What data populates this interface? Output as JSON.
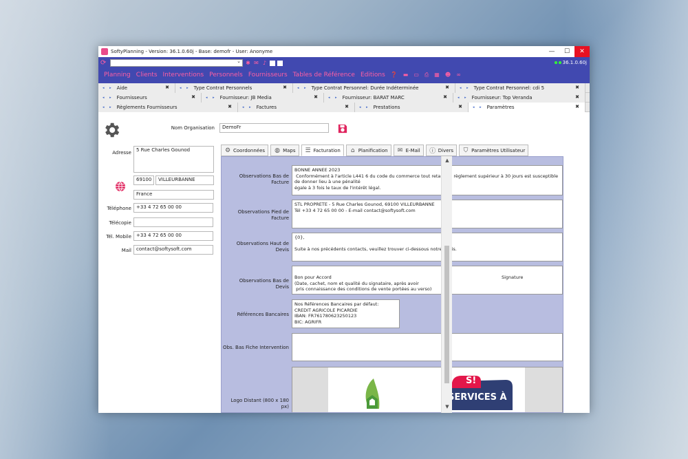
{
  "window": {
    "title": "SoftyPlanning - Version: 36.1.0.60j - Base: demofr - User: Anonyme",
    "controls": {
      "minimize": "—",
      "maximize": "☐",
      "close": "✕"
    }
  },
  "toolbar": {
    "combo_value": "",
    "version": "36.1.0.60j",
    "icons": [
      "refresh-icon",
      "puzzle-icon",
      "mail-icon",
      "microphone-icon"
    ]
  },
  "menu": {
    "items": [
      "Planning",
      "Clients",
      "Interventions",
      "Personnels",
      "Fournisseurs",
      "Tables de Référence",
      "Editions"
    ],
    "icons": [
      "help-icon",
      "folder-icon",
      "folder-open-icon",
      "print-icon",
      "calendar-icon",
      "user-add-icon",
      "link-icon"
    ]
  },
  "doc_tabs": {
    "row1": [
      {
        "label": "Aide",
        "close": "✖"
      },
      {
        "label": "Type Contrat Personnels",
        "close": "✖"
      },
      {
        "label": "Type Contrat Personnel: Durée Indéterminée",
        "close": "✖"
      },
      {
        "label": "Type Contrat Personnel: cdi 5",
        "close": "✖"
      }
    ],
    "row2": [
      {
        "label": "Fournisseurs",
        "close": "✖"
      },
      {
        "label": "Fournisseur: JB Media",
        "close": "✖"
      },
      {
        "label": "Fournisseur: BARAT MARC",
        "close": "✖"
      },
      {
        "label": "Fournisseur: Top Veranda",
        "close": "✖"
      }
    ],
    "row3": [
      {
        "label": "Règlements Fournisseurs",
        "close": "✖"
      },
      {
        "label": "Factures",
        "close": "✖"
      },
      {
        "label": "Prestations",
        "close": "✖"
      },
      {
        "label": "Paramètres",
        "close": "✖"
      }
    ],
    "nav": "◂ ▸"
  },
  "organisation": {
    "name_label": "Nom Organisation",
    "name_value": "DemoFr"
  },
  "address": {
    "label": "Adresse",
    "street": "5 Rue Charles Gounod",
    "postcode": "69100",
    "city": "VILLEURBANNE",
    "country": "France",
    "phone_label": "Téléphone",
    "phone": "+33 4 72 65 00 00",
    "fax_label": "Télécopie",
    "fax": "",
    "mobile_label": "Tél. Mobile",
    "mobile": "+33 4 72 65 00 00",
    "mail_label": "Mail",
    "mail": "contact@softysoft.com"
  },
  "section_tabs": [
    {
      "label": "Coordonnées",
      "icon": "gear-icon"
    },
    {
      "label": "Maps",
      "icon": "globe-icon"
    },
    {
      "label": "Facturation",
      "icon": "list-check-icon"
    },
    {
      "label": "Planification",
      "icon": "bank-icon"
    },
    {
      "label": "E-Mail",
      "icon": "mail-icon"
    },
    {
      "label": "Divers",
      "icon": "info-icon"
    },
    {
      "label": "Paramètres Utilisateur",
      "icon": "shield-icon"
    }
  ],
  "facturation": {
    "obs_bas_facture_label": "Observations Bas de Facture",
    "obs_bas_facture": "BONNE ANNEE 2023\n Conformément à l'article L441 6 du code du commerce tout retard de règlement supérieur à 30 jours est susceptible de donner lieu à une pénalité\négale à 3 fois le taux de l'intérêt légal.",
    "obs_pied_facture_label": "Observations Pied de Facture",
    "obs_pied_facture": "STL PROPRETE - 5 Rue Charles Gounod, 69100 VILLEURBANNE\nTél +33 4 72 65 00 00 - E-mail contact@softysoft.com",
    "obs_haut_devis_label": "Observations Haut de Devis",
    "obs_haut_devis": "{0},\n\nSuite à nos précédents contacts, veuillez trouver ci-dessous notre devis.",
    "obs_bas_devis_label": "Observations Bas de Devis",
    "obs_bas_devis_line1": "Bon pour Accord",
    "obs_bas_devis_signature": "Signature",
    "obs_bas_devis_line2": "(Date, cachet, nom et qualité du signataire, après avoir\n pris connaissance des conditions de vente portées au verso)",
    "ref_bancaires_label": "Références Bancaires",
    "ref_bancaires": "Nos Références Bancaires par défaut:\nCREDIT AGRICOLE PICARDIE\nIBAN: FR761780623250123\nBIC: AGRIFR",
    "obs_bas_fiche_label": "Obs. Bas Fiche Intervention",
    "obs_bas_fiche": "",
    "logo_label": "Logo Distant (800 x 180 px)",
    "logo_text": "SERVICES À",
    "logo_badge": "S!"
  },
  "colors": {
    "menubar": "#4149b0",
    "accent": "#ff5fa3",
    "panel": "#b8bde0",
    "close": "#e81123"
  }
}
